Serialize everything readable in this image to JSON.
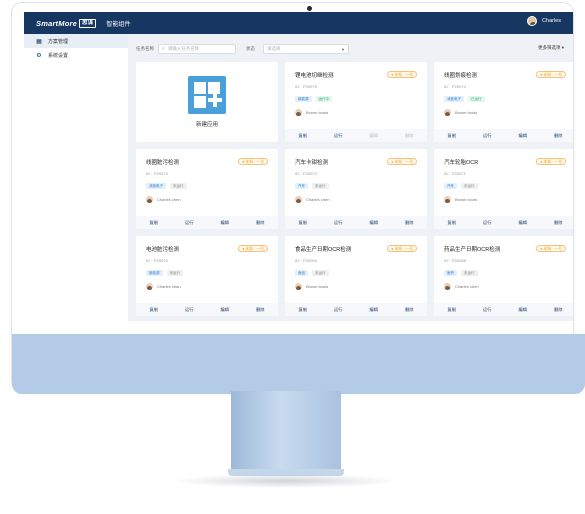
{
  "topbar": {
    "brand": "SmartMore",
    "brand_box": "思谋",
    "app_name": "智能组件",
    "user_name": "Charles"
  },
  "sidebar": {
    "items": [
      {
        "label": "方案管理",
        "icon": "grid-icon",
        "active": true
      },
      {
        "label": "系统设置",
        "icon": "gear-icon",
        "active": false
      }
    ]
  },
  "filters": {
    "name_label": "任务名称",
    "search_placeholder": "请输入任务名称",
    "status_label": "状态",
    "status_placeholder": "请选择",
    "more": "更多筛选项 ▾"
  },
  "new_card": {
    "label": "新建应用"
  },
  "actions": [
    "复制",
    "运行",
    "编辑",
    "删除"
  ],
  "cards": [
    {
      "title": "锂电池切继检测",
      "badge": "● 未知 · 一号",
      "id": "ID：P20075",
      "tags": [
        {
          "t": "新能源",
          "c": "blue"
        },
        {
          "t": "运行中",
          "c": "green"
        }
      ],
      "owner": "Brown boots",
      "actions_disabled": [
        false,
        false,
        true,
        true
      ]
    },
    {
      "title": "线圈划痕检测",
      "badge": "● 未知 · 一号",
      "id": "ID：P20074",
      "tags": [
        {
          "t": "消费电子",
          "c": "blue"
        },
        {
          "t": "已运行",
          "c": "green"
        }
      ],
      "owner": "Brown boots",
      "actions_disabled": [
        false,
        false,
        false,
        false
      ]
    },
    {
      "title": "线圈脏污检测",
      "badge": "● 未知 · 一号",
      "id": "ID：P20073",
      "tags": [
        {
          "t": "消费电子",
          "c": "blue"
        },
        {
          "t": "未运行",
          "c": "gray"
        }
      ],
      "owner": "Charles chen",
      "actions_disabled": [
        false,
        false,
        false,
        false
      ]
    },
    {
      "title": "汽车卡钳检测",
      "badge": "● 未知 · 一号",
      "id": "ID：P20072",
      "tags": [
        {
          "t": "汽车",
          "c": "blue"
        },
        {
          "t": "未运行",
          "c": "gray"
        }
      ],
      "owner": "Charles chen",
      "actions_disabled": [
        false,
        false,
        false,
        false
      ]
    },
    {
      "title": "汽车轮胎OCR",
      "badge": "● 未知 · 一号",
      "id": "ID：P20071",
      "tags": [
        {
          "t": "汽车",
          "c": "blue"
        },
        {
          "t": "未运行",
          "c": "gray"
        }
      ],
      "owner": "Brown boots",
      "actions_disabled": [
        false,
        false,
        false,
        false
      ]
    },
    {
      "title": "电池脏污检测",
      "badge": "● 未知 · 一号",
      "id": "ID：P20070",
      "tags": [
        {
          "t": "新能源",
          "c": "blue"
        },
        {
          "t": "未运行",
          "c": "gray"
        }
      ],
      "owner": "Charles chan",
      "actions_disabled": [
        false,
        false,
        false,
        false
      ]
    },
    {
      "title": "食品生产日期OCR检测",
      "badge": "● 未知 · 一号",
      "id": "ID：P20069",
      "tags": [
        {
          "t": "食品",
          "c": "blue"
        },
        {
          "t": "未运行",
          "c": "gray"
        }
      ],
      "owner": "Brown boots",
      "actions_disabled": [
        false,
        false,
        false,
        false
      ]
    },
    {
      "title": "药品生产日期OCR检测",
      "badge": "● 未知 · 一号",
      "id": "ID：P20068",
      "tags": [
        {
          "t": "医药",
          "c": "blue"
        },
        {
          "t": "未运行",
          "c": "gray"
        }
      ],
      "owner": "Charles chen",
      "actions_disabled": [
        false,
        false,
        false,
        false
      ]
    }
  ]
}
